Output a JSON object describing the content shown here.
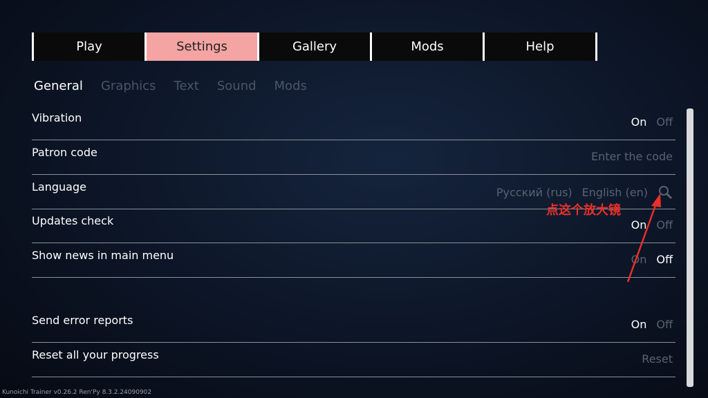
{
  "tabs": [
    "Play",
    "Settings",
    "Gallery",
    "Mods",
    "Help"
  ],
  "subtabs": [
    "General",
    "Graphics",
    "Text",
    "Sound",
    "Mods"
  ],
  "rows": [
    {
      "label": "Vibration",
      "on": "On",
      "off": "Off"
    },
    {
      "label": "Patron code",
      "placeholder": "Enter the code"
    },
    {
      "label": "Language",
      "lang1": "Русский (rus)",
      "lang2": "English (en)"
    },
    {
      "label": "Updates check",
      "on": "On",
      "off": "Off"
    },
    {
      "label": "Show news in main menu",
      "on": "On",
      "off": "Off"
    },
    {
      "label": "Send error reports",
      "on": "On",
      "off": "Off"
    },
    {
      "label": "Reset all your progress",
      "reset": "Reset"
    }
  ],
  "footer": "Kunoichi Trainer v0.26.2   Ren'Py 8.3.2.24090902",
  "annotation": "点这个放大镜",
  "colors": {
    "active_tab": "#f4a4a2",
    "annotation": "#e8302a"
  }
}
